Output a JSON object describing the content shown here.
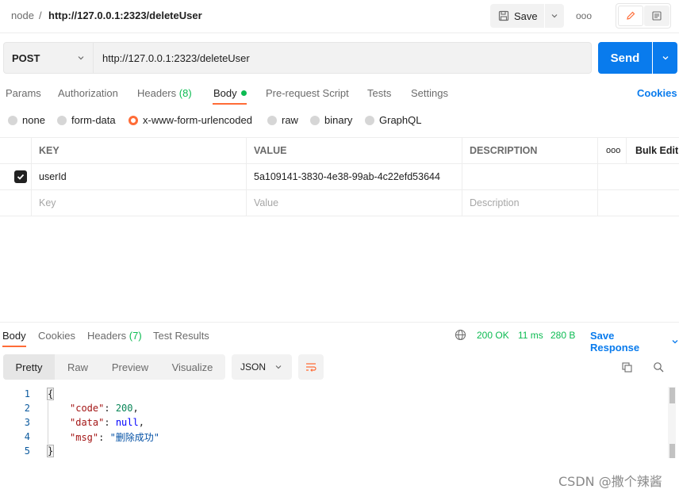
{
  "topbar": {
    "breadcrumb_parent": "node",
    "breadcrumb_separator": "/",
    "breadcrumb_current": "http://127.0.0.1:2323/deleteUser",
    "save_label": "Save",
    "more_label": "ooo"
  },
  "request": {
    "method": "POST",
    "url": "http://127.0.0.1:2323/deleteUser",
    "send_label": "Send"
  },
  "request_tabs": {
    "params": "Params",
    "authorization": "Authorization",
    "headers": "Headers",
    "headers_count": "(8)",
    "body": "Body",
    "pre_request": "Pre-request Script",
    "tests": "Tests",
    "settings": "Settings",
    "cookies": "Cookies"
  },
  "body_types": {
    "none": "none",
    "form_data": "form-data",
    "urlencoded": "x-www-form-urlencoded",
    "raw": "raw",
    "binary": "binary",
    "graphql": "GraphQL",
    "selected": "x-www-form-urlencoded"
  },
  "params_table": {
    "headers": {
      "key": "KEY",
      "value": "VALUE",
      "description": "DESCRIPTION",
      "more": "ooo",
      "bulk_edit": "Bulk Edit"
    },
    "rows": [
      {
        "checked": true,
        "key": "userId",
        "value": "5a109141-3830-4e38-99ab-4c22efd53644",
        "description": ""
      }
    ],
    "placeholders": {
      "key": "Key",
      "value": "Value",
      "description": "Description"
    }
  },
  "response": {
    "tabs": {
      "body": "Body",
      "cookies": "Cookies",
      "headers": "Headers",
      "headers_count": "(7)",
      "test_results": "Test Results"
    },
    "status": "200 OK",
    "time": "11 ms",
    "size": "280 B",
    "save_response": "Save Response",
    "modes": {
      "pretty": "Pretty",
      "raw": "Raw",
      "preview": "Preview",
      "visualize": "Visualize"
    },
    "format": "JSON",
    "code_lines": [
      {
        "n": "1",
        "text": "{"
      },
      {
        "n": "2",
        "key": "\"code\"",
        "sep": ": ",
        "val": "200",
        "end": ","
      },
      {
        "n": "3",
        "key": "\"data\"",
        "sep": ": ",
        "val": "null",
        "end": ","
      },
      {
        "n": "4",
        "key": "\"msg\"",
        "sep": ": ",
        "val": "\"删除成功\"",
        "end": ""
      },
      {
        "n": "5",
        "text": "}"
      }
    ]
  },
  "watermark": "CSDN @撒个辣酱",
  "colors": {
    "accent": "#ff6c37",
    "primary": "#097bed",
    "success": "#0cbb52"
  }
}
